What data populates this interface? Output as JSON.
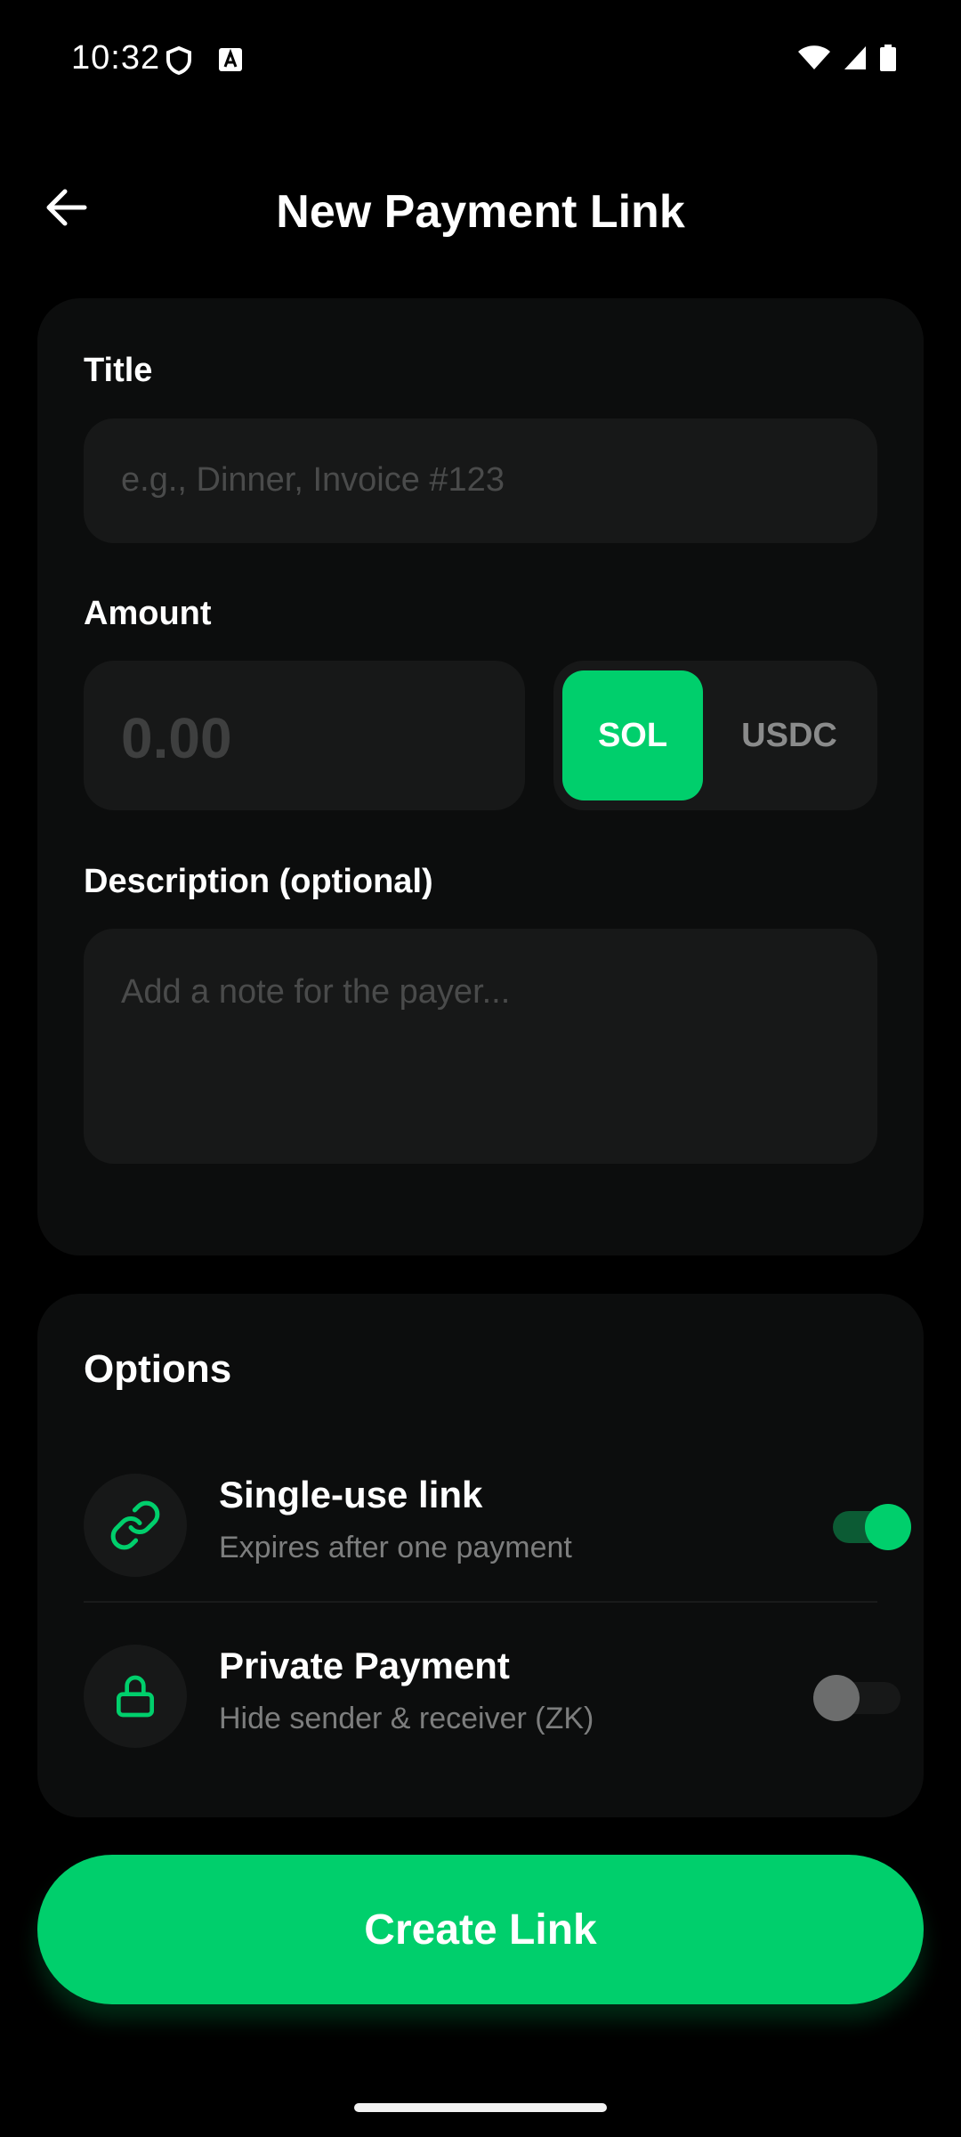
{
  "status_bar": {
    "time": "10:32"
  },
  "header": {
    "title": "New Payment Link"
  },
  "form": {
    "title_label": "Title",
    "title_placeholder": "e.g., Dinner, Invoice #123",
    "amount_label": "Amount",
    "amount_placeholder": "0.00",
    "currency_options": [
      "SOL",
      "USDC"
    ],
    "selected_currency": "SOL",
    "description_label": "Description (optional)",
    "description_placeholder": "Add a note for the payer..."
  },
  "options": {
    "title": "Options",
    "items": [
      {
        "title": "Single-use link",
        "subtitle": "Expires after one payment",
        "icon": "link-icon",
        "enabled": true
      },
      {
        "title": "Private Payment",
        "subtitle": "Hide sender & receiver (ZK)",
        "icon": "lock-icon",
        "enabled": false
      }
    ]
  },
  "cta": {
    "label": "Create Link"
  },
  "colors": {
    "accent": "#00cf6c",
    "background": "#000000",
    "card": "#0c0d0d",
    "input": "#171818"
  }
}
